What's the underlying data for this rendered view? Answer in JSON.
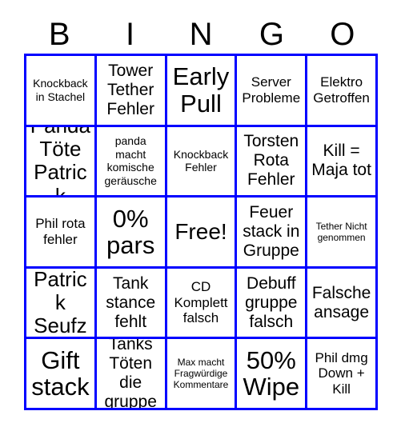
{
  "card": {
    "title": "BINGO",
    "header_letters": [
      "B",
      "I",
      "N",
      "G",
      "O"
    ],
    "border_color": "#0000FF",
    "background_color": "#FFFFFF",
    "text_color": "#000000",
    "rows": 5,
    "columns": 5,
    "free_space_label": "Free!",
    "free_space_position": "row3-col3"
  },
  "cells": [
    {
      "text": "Knockback in Stachel",
      "size": "s"
    },
    {
      "text": "Tower Tether Fehler",
      "size": "l"
    },
    {
      "text": "Early Pull",
      "size": "xxl"
    },
    {
      "text": "Server Probleme",
      "size": "m"
    },
    {
      "text": "Elektro Getroffen",
      "size": "m"
    },
    {
      "text": "Panda Töte Patrick",
      "size": "xl"
    },
    {
      "text": "panda macht komische geräusche",
      "size": "s"
    },
    {
      "text": "Knockback Fehler",
      "size": "s"
    },
    {
      "text": "Torsten Rota Fehler",
      "size": "l"
    },
    {
      "text": "Kill = Maja tot",
      "size": "l"
    },
    {
      "text": "Phil rota fehler",
      "size": "m"
    },
    {
      "text": "0% pars",
      "size": "xxl"
    },
    {
      "text": "Free!",
      "size": "free"
    },
    {
      "text": "Feuer stack in Gruppe",
      "size": "l"
    },
    {
      "text": "Tether Nicht genommen",
      "size": "xs"
    },
    {
      "text": "Patrick Seufz",
      "size": "xl"
    },
    {
      "text": "Tank stance fehlt",
      "size": "l"
    },
    {
      "text": "CD Komplett falsch",
      "size": "m"
    },
    {
      "text": "Debuff gruppe falsch",
      "size": "l"
    },
    {
      "text": "Falsche ansage",
      "size": "l"
    },
    {
      "text": "Gift stack",
      "size": "xxl"
    },
    {
      "text": "Tanks Töten die gruppe",
      "size": "l"
    },
    {
      "text": "Max macht Fragwürdige Kommentare",
      "size": "xs"
    },
    {
      "text": "50% Wipe",
      "size": "xxl"
    },
    {
      "text": "Phil dmg Down + Kill",
      "size": "m"
    }
  ]
}
